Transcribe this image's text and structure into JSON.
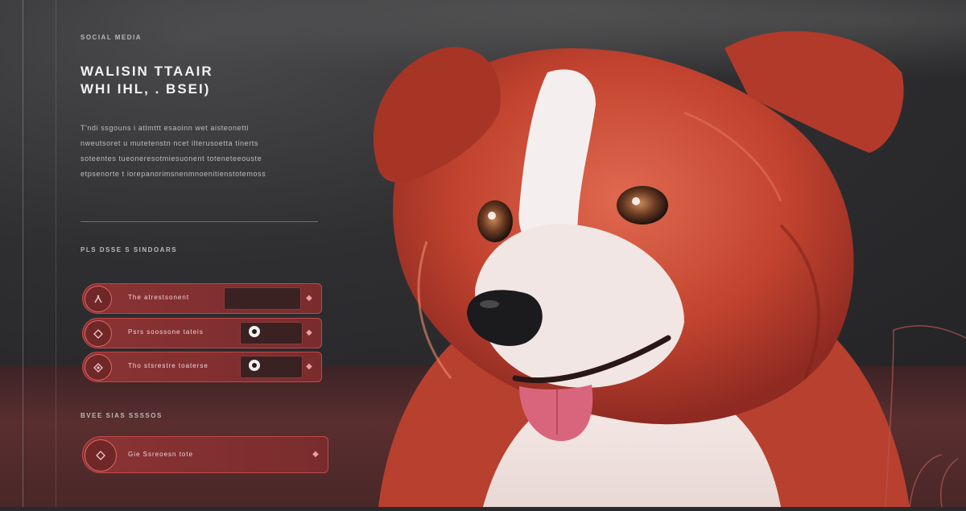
{
  "panel": {
    "eyebrow": "SOCIAL MEDIA",
    "title_line_1": "WALISIN TTAAIR",
    "title_line_2": "WHI IHL, . BSEI)",
    "paragraph": [
      "T'ndi ssgouns i atlmttt esaoinn wet aisteonetti",
      "nweutsoret u mutetenstn ncet ilterusoetta tinerts",
      "soteentes tueoneresotmiesuonent toteneteeouste",
      "etpsenorte t iorepanorimsnenmnoenitienstotemoss"
    ],
    "section_label": "PLS DSSE S SINDOARS",
    "options": [
      {
        "label": "The atrestsonent",
        "icon": "paw-icon",
        "state": "filled"
      },
      {
        "label": "Psrs soossone tateis",
        "icon": "diamond-icon",
        "state": "radio"
      },
      {
        "label": "Tho stsrestre toaterse",
        "icon": "target-icon",
        "state": "radio"
      }
    ],
    "section_label_2": "BVEE  SIAS SSSSOS",
    "cta": {
      "label": "Gie Ssreoesn tote",
      "icon": "diamond-icon"
    }
  },
  "colors": {
    "accent": "#c0494a",
    "row_bg": "#7a2c2d",
    "dog_fur": "#c94a3a"
  }
}
